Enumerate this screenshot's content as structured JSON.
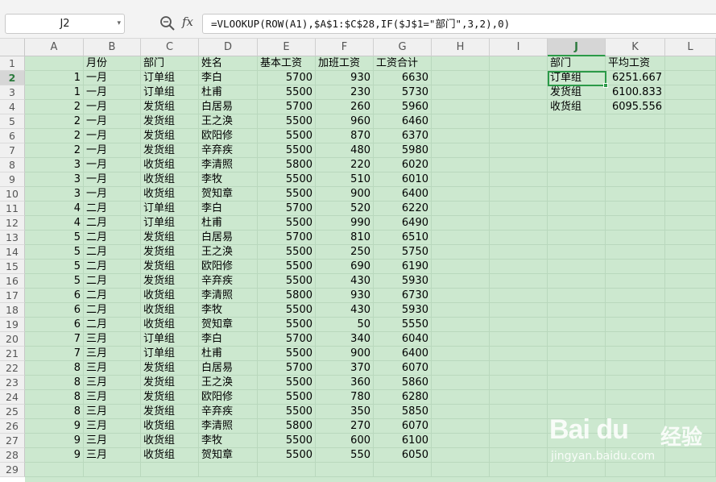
{
  "formula_bar": {
    "name_box": "J2",
    "zoom_icon": "zoom-icon",
    "fx_label": "fx",
    "formula": "=VLOOKUP(ROW(A1),$A$1:$C$28,IF($J$1=\"部门\",3,2),0)"
  },
  "columns": [
    "A",
    "B",
    "C",
    "D",
    "E",
    "F",
    "G",
    "H",
    "I",
    "J",
    "K",
    "L"
  ],
  "active_column": "J",
  "active_row": "2",
  "active_cell": "J2",
  "rows": [
    "1",
    "2",
    "3",
    "4",
    "5",
    "6",
    "7",
    "8",
    "9",
    "10",
    "11",
    "12",
    "13",
    "14",
    "15",
    "16",
    "17",
    "18",
    "19",
    "20",
    "21",
    "22",
    "23",
    "24",
    "25",
    "26",
    "27",
    "28",
    "29"
  ],
  "headers": [
    "",
    "月份",
    "部门",
    "姓名",
    "基本工资",
    "加班工资",
    "工资合计"
  ],
  "data": [
    [
      "1",
      "一月",
      "订单组",
      "李白",
      "5700",
      "930",
      "6630"
    ],
    [
      "1",
      "一月",
      "订单组",
      "杜甫",
      "5500",
      "230",
      "5730"
    ],
    [
      "2",
      "一月",
      "发货组",
      "白居易",
      "5700",
      "260",
      "5960"
    ],
    [
      "2",
      "一月",
      "发货组",
      "王之涣",
      "5500",
      "960",
      "6460"
    ],
    [
      "2",
      "一月",
      "发货组",
      "欧阳修",
      "5500",
      "870",
      "6370"
    ],
    [
      "2",
      "一月",
      "发货组",
      "辛弃疾",
      "5500",
      "480",
      "5980"
    ],
    [
      "3",
      "一月",
      "收货组",
      "李清照",
      "5800",
      "220",
      "6020"
    ],
    [
      "3",
      "一月",
      "收货组",
      "李牧",
      "5500",
      "510",
      "6010"
    ],
    [
      "3",
      "一月",
      "收货组",
      "贺知章",
      "5500",
      "900",
      "6400"
    ],
    [
      "4",
      "二月",
      "订单组",
      "李白",
      "5700",
      "520",
      "6220"
    ],
    [
      "4",
      "二月",
      "订单组",
      "杜甫",
      "5500",
      "990",
      "6490"
    ],
    [
      "5",
      "二月",
      "发货组",
      "白居易",
      "5700",
      "810",
      "6510"
    ],
    [
      "5",
      "二月",
      "发货组",
      "王之涣",
      "5500",
      "250",
      "5750"
    ],
    [
      "5",
      "二月",
      "发货组",
      "欧阳修",
      "5500",
      "690",
      "6190"
    ],
    [
      "5",
      "二月",
      "发货组",
      "辛弃疾",
      "5500",
      "430",
      "5930"
    ],
    [
      "6",
      "二月",
      "收货组",
      "李清照",
      "5800",
      "930",
      "6730"
    ],
    [
      "6",
      "二月",
      "收货组",
      "李牧",
      "5500",
      "430",
      "5930"
    ],
    [
      "6",
      "二月",
      "收货组",
      "贺知章",
      "5500",
      "50",
      "5550"
    ],
    [
      "7",
      "三月",
      "订单组",
      "李白",
      "5700",
      "340",
      "6040"
    ],
    [
      "7",
      "三月",
      "订单组",
      "杜甫",
      "5500",
      "900",
      "6400"
    ],
    [
      "8",
      "三月",
      "发货组",
      "白居易",
      "5700",
      "370",
      "6070"
    ],
    [
      "8",
      "三月",
      "发货组",
      "王之涣",
      "5500",
      "360",
      "5860"
    ],
    [
      "8",
      "三月",
      "发货组",
      "欧阳修",
      "5500",
      "780",
      "6280"
    ],
    [
      "8",
      "三月",
      "发货组",
      "辛弃疾",
      "5500",
      "350",
      "5850"
    ],
    [
      "9",
      "三月",
      "收货组",
      "李清照",
      "5800",
      "270",
      "6070"
    ],
    [
      "9",
      "三月",
      "收货组",
      "李牧",
      "5500",
      "600",
      "6100"
    ],
    [
      "9",
      "三月",
      "收货组",
      "贺知章",
      "5500",
      "550",
      "6050"
    ]
  ],
  "summary": {
    "headers": [
      "部门",
      "平均工资"
    ],
    "rows": [
      [
        "订单组",
        "6251.667"
      ],
      [
        "发货组",
        "6100.833"
      ],
      [
        "收货组",
        "6095.556"
      ]
    ]
  },
  "watermark": {
    "brand": "Bai du",
    "brand_cn": "经验",
    "url": "jingyan.baidu.com"
  },
  "colors": {
    "grid_fill": "#cce8cf",
    "active_border": "#2b9a48"
  }
}
